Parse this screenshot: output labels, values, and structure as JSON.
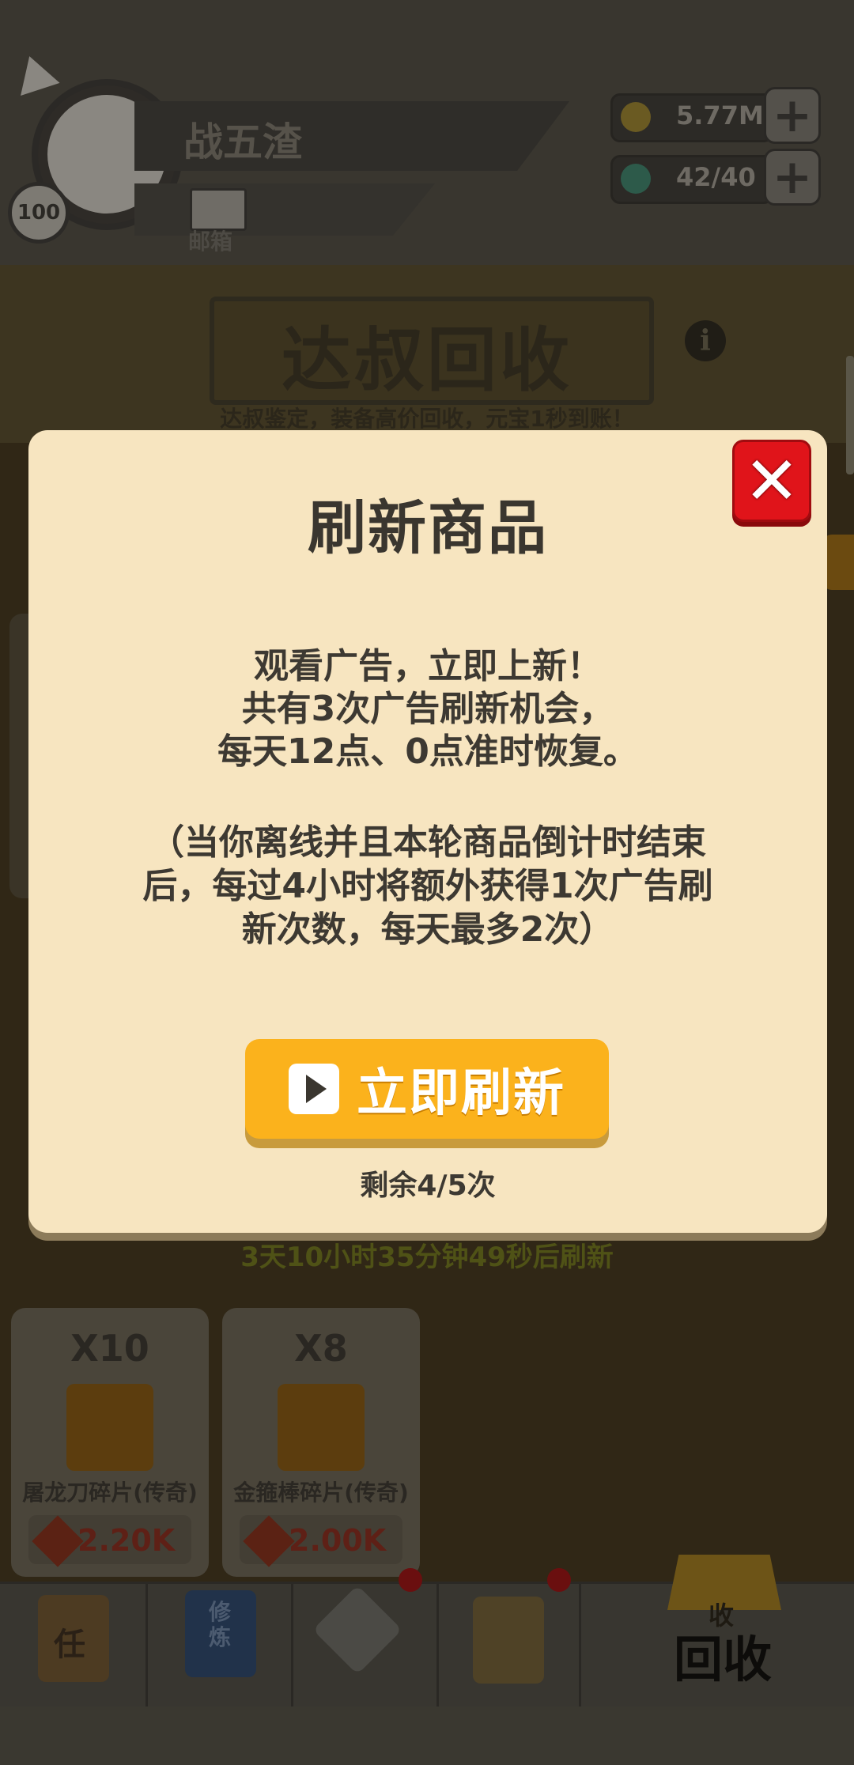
{
  "player": {
    "name": "战五渣",
    "level": "100",
    "mail_label": "邮箱"
  },
  "resources": {
    "coins": "5.77M",
    "gems": "42/40"
  },
  "banner": {
    "title": "达叔回收",
    "subtitle": "达叔鉴定，装备高价回收，元宝1秒到账！"
  },
  "shop": {
    "refresh_timer": "3天10小时35分钟49秒后刷新",
    "items": [
      {
        "count": "X10",
        "name": "屠龙刀碎片(传奇)",
        "price": "2.20K"
      },
      {
        "count": "X8",
        "name": "金箍棒碎片(传奇)",
        "price": "2.00K"
      }
    ]
  },
  "nav": {
    "task_glyph": "任",
    "cultivate_glyph": "修炼",
    "recycle_glyph": "收",
    "recycle_label": "回收"
  },
  "modal": {
    "title": "刷新商品",
    "body_lines": [
      "观看广告，立即上新！",
      "共有3次广告刷新机会，",
      "每天12点、0点准时恢复。"
    ],
    "note_lines": [
      "（当你离线并且本轮商品倒计时结束",
      "后，每过4小时将额外获得1次广告刷",
      "新次数，每天最多2次）"
    ],
    "button_label": "立即刷新",
    "remaining": "剩余4/5次",
    "close_glyph": "✕"
  },
  "colors": {
    "modal_bg": "#f7e5c0",
    "button": "#fbb21c",
    "close": "#e0141a"
  }
}
